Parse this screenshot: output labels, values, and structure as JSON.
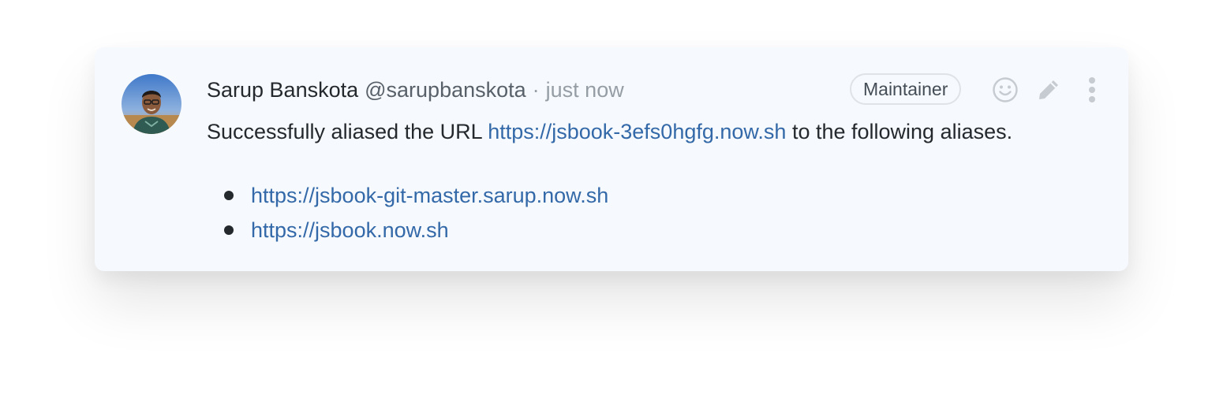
{
  "comment": {
    "author_name": "Sarup Banskota",
    "author_handle": "@sarupbanskota",
    "separator": "·",
    "timestamp": "just now",
    "role_badge": "Maintainer",
    "actions": {
      "reaction_icon": "smile-icon",
      "edit_icon": "pencil-icon",
      "more_icon": "kebab-menu-icon"
    },
    "message": {
      "prefix": "Successfully aliased the URL",
      "url": "https://jsbook-3efs0hgfg.now.sh",
      "suffix": "to the following aliases."
    },
    "aliases": [
      "https://jsbook-git-master.sarup.now.sh",
      "https://jsbook.now.sh"
    ]
  },
  "colors": {
    "card_background": "#f6f9fd",
    "link": "#3369a8",
    "text": "#24292e",
    "muted": "#959da5"
  }
}
